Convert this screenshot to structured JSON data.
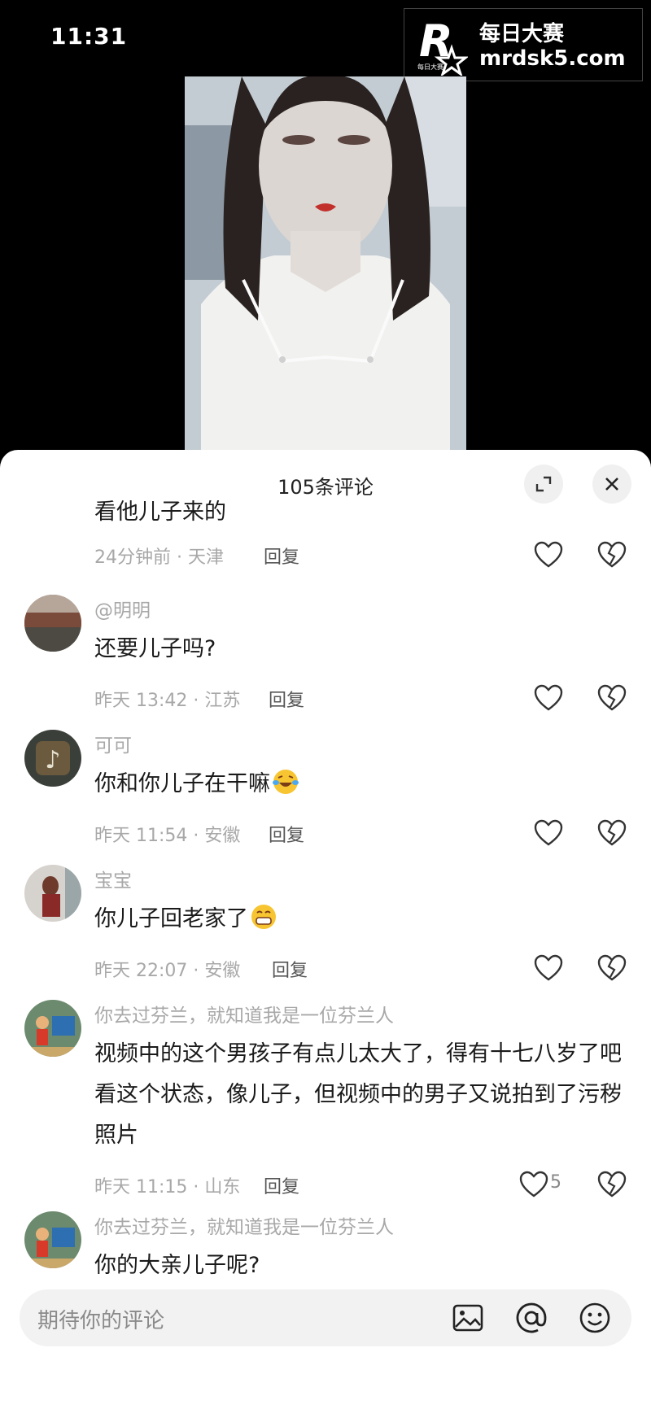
{
  "status": {
    "time": "11:31"
  },
  "watermark": {
    "title": "每日大赛",
    "url": "mrdsk5.com",
    "logo_letter": "R"
  },
  "sheet": {
    "title": "105条评论",
    "expand_icon": "expand-icon",
    "close_icon": "close-icon"
  },
  "comments": [
    {
      "user": "",
      "text": "看他儿子来的",
      "time": "24分钟前 · 天津",
      "reply": "回复",
      "likes": ""
    },
    {
      "user": "@明明",
      "text": "还要儿子吗?",
      "time": "昨天 13:42 · 江苏",
      "reply": "回复",
      "likes": ""
    },
    {
      "user": "可可",
      "text": "你和你儿子在干嘛",
      "emoji": "laughing-tears-emoji",
      "time": "昨天 11:54 · 安徽",
      "reply": "回复",
      "likes": ""
    },
    {
      "user": "宝宝",
      "text": "你儿子回老家了",
      "emoji": "grinning-emoji",
      "time": "昨天 22:07 · 安徽",
      "reply": "回复",
      "likes": ""
    },
    {
      "user": "你去过芬兰，就知道我是一位芬兰人",
      "text": "视频中的这个男孩子有点儿太大了，得有十七八岁了吧看这个状态，像儿子，但视频中的男子又说拍到了污秽照片",
      "time": "昨天 11:15 · 山东",
      "reply": "回复",
      "likes": "5"
    },
    {
      "user": "你去过芬兰，就知道我是一位芬兰人",
      "text": "你的大亲儿子呢?",
      "time": "",
      "reply": "",
      "likes": ""
    }
  ],
  "input": {
    "placeholder": "期待你的评论",
    "icons": [
      "image-icon",
      "at-icon",
      "emoji-icon"
    ]
  },
  "colors": {
    "accent_bg": "#ffffff",
    "muted_text": "#a8a8a8"
  }
}
